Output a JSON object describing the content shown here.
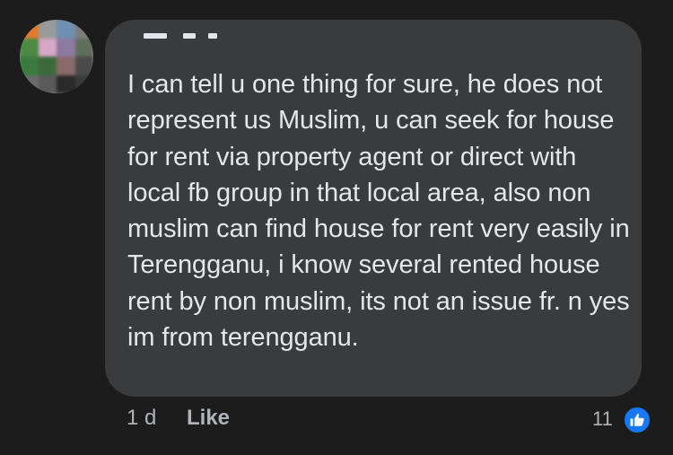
{
  "comment": {
    "author_name": "",
    "text": "I can tell u one thing for sure, he does not represent us Muslim, u can seek for house for rent via property agent or direct with local fb group in that local area, also non muslim can find house for rent very easily in Terengganu, i know several rented house rent by non muslim, its not an issue fr. n yes im from terengganu.",
    "time_ago": "1 d",
    "like_label": "Like",
    "reaction_count": "11",
    "reaction_icon": "thumbs-up-icon"
  },
  "avatar": {
    "pixels": [
      "#e07a2e",
      "#9a9a9a",
      "#6f8fb0",
      "#7d7d7d",
      "#4c8a44",
      "#d8a6c6",
      "#8c7aa0",
      "#5e6e5a",
      "#3a7a3e",
      "#3a6a3a",
      "#8a6a6a",
      "#4a4a4a",
      "#6a6a6a",
      "#5a5a5a",
      "#2a2a2a",
      "#3a3a3a"
    ]
  },
  "colors": {
    "background": "#1c1c1d",
    "bubble": "#3a3b3c",
    "text": "#e4e6eb",
    "secondary_text": "#b0b3b8",
    "like_blue": "#1877f2"
  }
}
